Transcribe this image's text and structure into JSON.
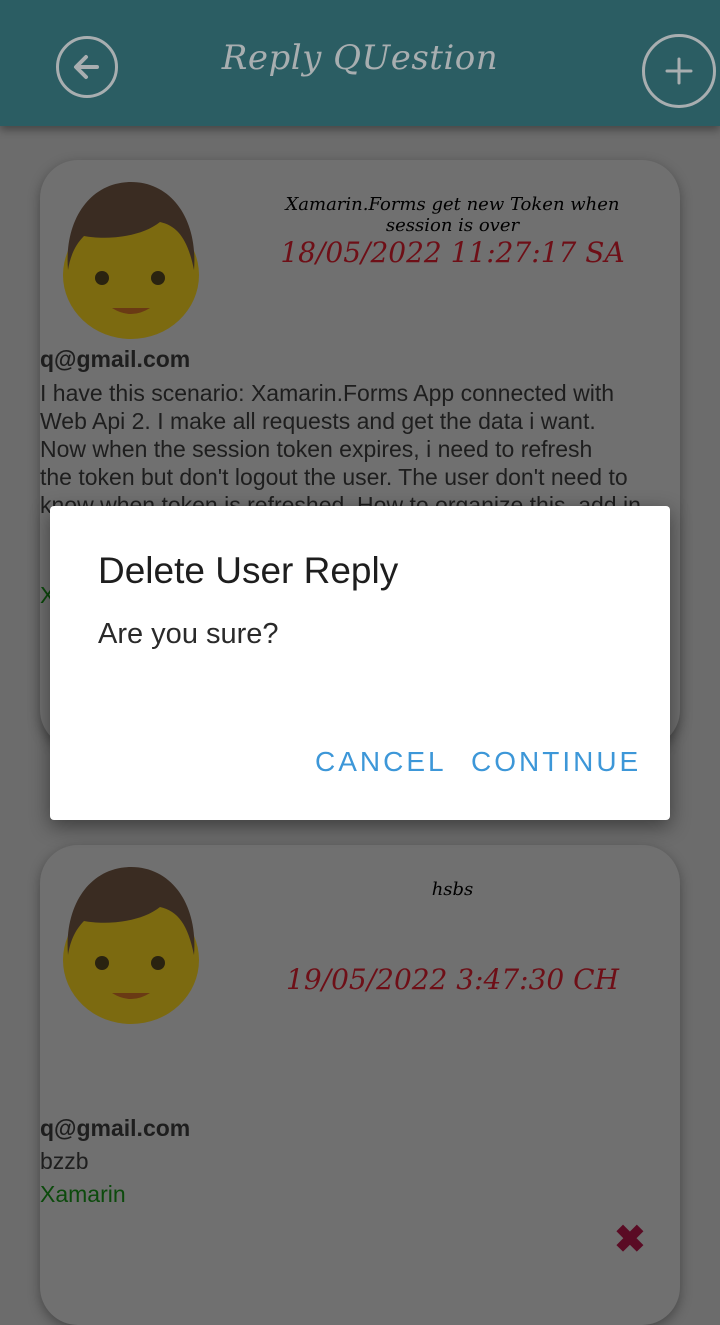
{
  "app_bar": {
    "title": "Reply QUestion",
    "back_icon": "arrow-left-circle-icon",
    "add_icon": "plus-circle-icon"
  },
  "questions": [
    {
      "title": "Xamarin.Forms get new Token when session is over",
      "date": "18/05/2022 11:27:17 SA",
      "email": "q@gmail.com",
      "lines": [
        "I have this scenario: Xamarin.Forms App connected with",
        "Web Api 2. I make all requests and get the data i want.",
        "Now when the session token expires, i need to refresh",
        "the token but don't logout the user. The user don't need to",
        "know when token is refreshed. How to organize this, add in"
      ],
      "tag": "X"
    },
    {
      "title": "hsbs",
      "date": "19/05/2022 3:47:30 CH",
      "email": "q@gmail.com",
      "lines": [
        "bzzb"
      ],
      "tag": "Xamarin"
    }
  ],
  "dialog": {
    "title": "Delete User Reply",
    "message": "Are you sure?",
    "cancel_label": "CANCEL",
    "continue_label": "CONTINUE"
  },
  "colors": {
    "app_bar": "#2b5d63",
    "dialog_button": "#3d97d8",
    "date": "#6e0f17",
    "tag": "#0c4a0c",
    "delete_icon": "#5a0b24"
  }
}
